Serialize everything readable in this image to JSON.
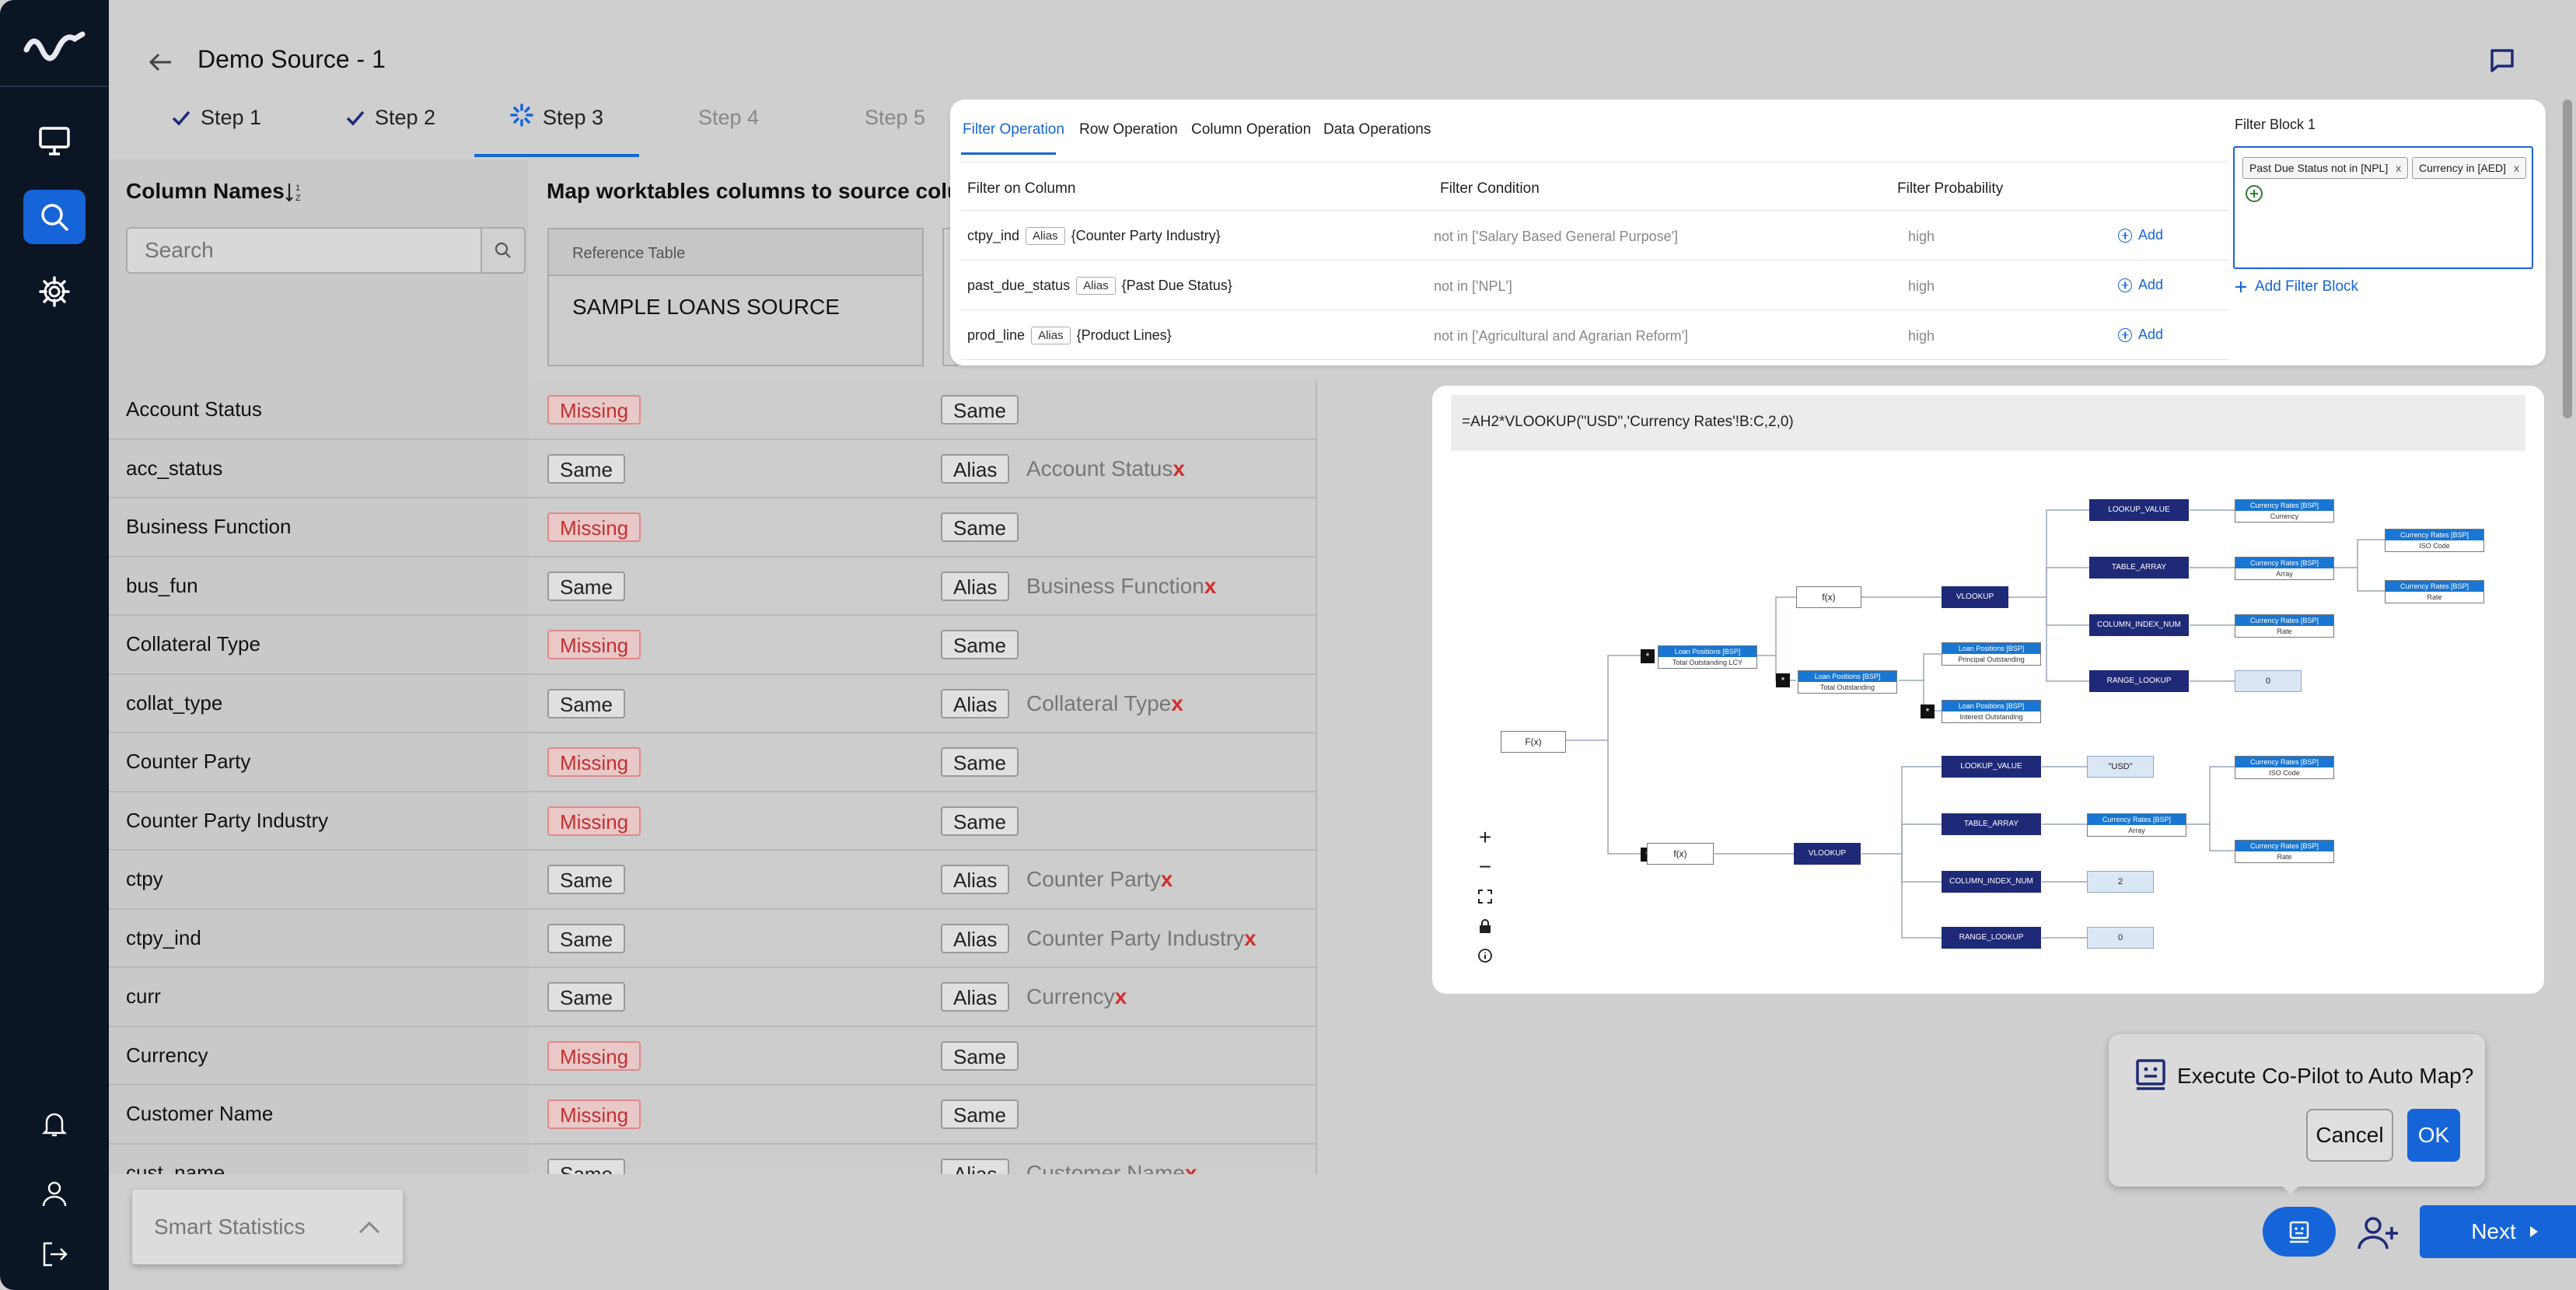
{
  "header": {
    "title": "Demo Source - 1"
  },
  "steps": [
    {
      "label": "Step 1",
      "state": "done"
    },
    {
      "label": "Step 2",
      "state": "done"
    },
    {
      "label": "Step 3",
      "state": "active"
    },
    {
      "label": "Step 4",
      "state": "pending"
    },
    {
      "label": "Step 5",
      "state": "pending"
    }
  ],
  "left": {
    "column_names_title": "Column Names",
    "search_placeholder": "Search"
  },
  "map": {
    "title": "Map worktables columns to source column",
    "ref_label": "Reference Table",
    "ref_value": "SAMPLE LOANS SOURCE"
  },
  "rows": [
    {
      "name": "Account Status",
      "status": "Missing",
      "type": "Same",
      "alias_of": ""
    },
    {
      "name": "acc_status",
      "status": "Same",
      "type": "Alias",
      "alias_of": "Account Status"
    },
    {
      "name": "Business Function",
      "status": "Missing",
      "type": "Same",
      "alias_of": ""
    },
    {
      "name": "bus_fun",
      "status": "Same",
      "type": "Alias",
      "alias_of": "Business Function"
    },
    {
      "name": "Collateral Type",
      "status": "Missing",
      "type": "Same",
      "alias_of": ""
    },
    {
      "name": "collat_type",
      "status": "Same",
      "type": "Alias",
      "alias_of": "Collateral Type"
    },
    {
      "name": "Counter Party",
      "status": "Missing",
      "type": "Same",
      "alias_of": ""
    },
    {
      "name": "Counter Party Industry",
      "status": "Missing",
      "type": "Same",
      "alias_of": ""
    },
    {
      "name": "ctpy",
      "status": "Same",
      "type": "Alias",
      "alias_of": "Counter Party"
    },
    {
      "name": "ctpy_ind",
      "status": "Same",
      "type": "Alias",
      "alias_of": "Counter Party Industry"
    },
    {
      "name": "curr",
      "status": "Same",
      "type": "Alias",
      "alias_of": "Currency"
    },
    {
      "name": "Currency",
      "status": "Missing",
      "type": "Same",
      "alias_of": ""
    },
    {
      "name": "Customer Name",
      "status": "Missing",
      "type": "Same",
      "alias_of": ""
    },
    {
      "name": "cust_name",
      "status": "Same",
      "type": "Alias",
      "alias_of": "Customer Name"
    }
  ],
  "remove_mark": "x",
  "smart_stats": {
    "label": "Smart Statistics"
  },
  "filter": {
    "tabs": [
      "Filter Operation",
      "Row Operation",
      "Column Operation",
      "Data Operations"
    ],
    "headers": {
      "column": "Filter on Column",
      "condition": "Filter Condition",
      "probability": "Filter Probability"
    },
    "rows": [
      {
        "column": "ctpy_ind",
        "alias_badge": "Alias",
        "alias": "{Counter Party Industry}",
        "condition": "not in ['Salary Based General Purpose']",
        "probability": "high",
        "action": "Add"
      },
      {
        "column": "past_due_status",
        "alias_badge": "Alias",
        "alias": "{Past Due Status}",
        "condition": "not in ['NPL']",
        "probability": "high",
        "action": "Add"
      },
      {
        "column": "prod_line",
        "alias_badge": "Alias",
        "alias": "{Product Lines}",
        "condition": "not in ['Agricultural and Agrarian Reform']",
        "probability": "high",
        "action": "Add"
      }
    ],
    "block_title": "Filter Block 1",
    "chips": [
      "Past Due Status not in [NPL]",
      "Currency in [AED]"
    ],
    "chip_close": "x",
    "add_block": "Add Filter Block"
  },
  "formula": {
    "expression": "=AH2*VLOOKUP(\"USD\",'Currency Rates'!B:C,2,0)",
    "tree": {
      "root": "F(x)",
      "op": "*",
      "f": "f(x)",
      "vlookup": "VLOOKUP",
      "lookup_value": "LOOKUP_VALUE",
      "table_array": "TABLE_ARRAY",
      "column_index_num": "COLUMN_INDEX_NUM",
      "range_lookup": "RANGE_LOOKUP",
      "lp": "Loan Positions [BSP]",
      "total_outstanding_lcy": "Total Outstanding LCY",
      "total_outstanding": "Total Outstanding",
      "principal_outstanding": "Principal Outstanding",
      "interest_outstanding": "Interest Outstanding",
      "cr": "Currency Rates [BSP]",
      "currency": "Currency",
      "array": "Array",
      "rate": "Rate",
      "iso_code": "ISO Code",
      "zero": "0",
      "two": "2",
      "usd": "\"USD\""
    },
    "zoom": {
      "plus": "+",
      "minus": "−"
    }
  },
  "copilot": {
    "message": "Execute Co-Pilot to Auto Map?",
    "cancel": "Cancel",
    "ok": "OK"
  },
  "footer": {
    "next": "Next"
  },
  "colors": {
    "accent": "#1565d8",
    "sidebar": "#0c1524",
    "missing": "#c53030",
    "node_dark": "#1e2a78"
  }
}
